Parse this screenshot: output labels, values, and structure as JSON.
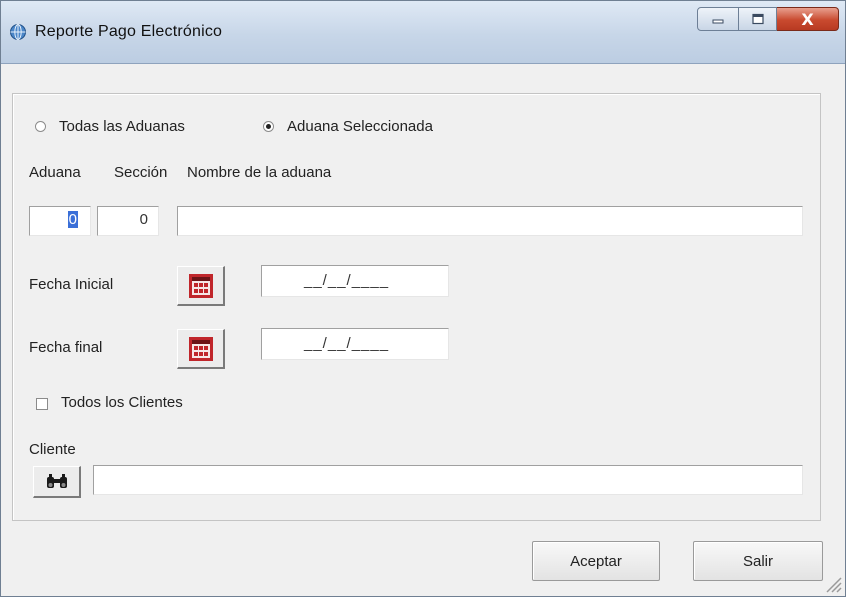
{
  "window": {
    "title": "Reporte Pago Electrónico",
    "close_glyph": "X"
  },
  "scope": {
    "option_all": "Todas las Aduanas",
    "option_selected": "Aduana Seleccionada",
    "selected": "option_selected"
  },
  "aduana_table": {
    "col_aduana": "Aduana",
    "col_seccion": "Sección",
    "col_nombre": "Nombre de la aduana",
    "aduana_value": "0",
    "seccion_value": "0",
    "nombre_value": ""
  },
  "fecha_inicial": {
    "label": "Fecha Inicial",
    "value": "__/__/____",
    "icon": "calendar-icon"
  },
  "fecha_final": {
    "label": "Fecha final",
    "value": "__/__/____",
    "icon": "calendar-icon"
  },
  "clientes": {
    "all_label": "Todos los Clientes",
    "all_checked": false,
    "cliente_label": "Cliente",
    "cliente_value": "",
    "search_icon": "binoculars-icon"
  },
  "actions": {
    "accept_label": "Aceptar",
    "exit_label": "Salir"
  },
  "colors": {
    "titlebar": "#c7d6e8",
    "close_button": "#c94a2f",
    "calendar_icon": "#c0262b",
    "selection": "#3a6fd8"
  }
}
